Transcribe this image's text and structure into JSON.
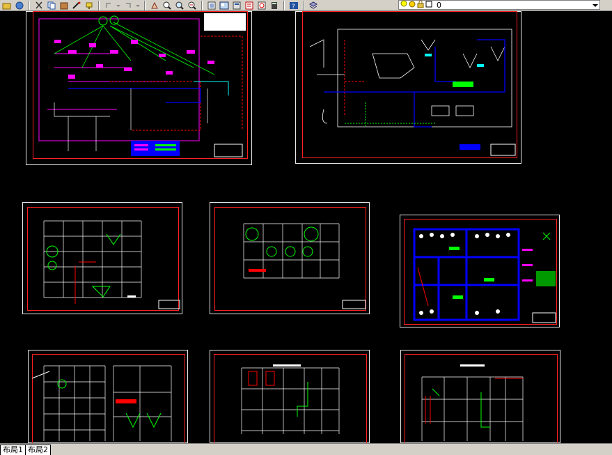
{
  "toolbar": {
    "icons": [
      "open-icon",
      "plot-icon",
      "cut-icon",
      "copy-icon",
      "paste-icon",
      "matchprop-icon",
      "brush-icon",
      "undo-icon",
      "redo-icon",
      "pan-icon",
      "zoom-realtime-icon",
      "zoom-window-icon",
      "zoom-previous-icon",
      "properties-icon",
      "designcenter-icon",
      "toolpalette-icon",
      "sheetset-icon",
      "markup-icon",
      "calculator-icon",
      "help-icon"
    ],
    "layer_value": "0"
  },
  "colors": {
    "background": "#000000",
    "sheet_border": "#e8e8e8",
    "frame": "#ff2020",
    "magenta": "#ff00ff",
    "green": "#00ff00",
    "blue": "#0000ff",
    "cyan": "#00ffff",
    "red": "#ff0000",
    "white": "#ffffff"
  },
  "layout_tabs": [
    {
      "label": "布局1"
    },
    {
      "label": "布局2"
    }
  ]
}
